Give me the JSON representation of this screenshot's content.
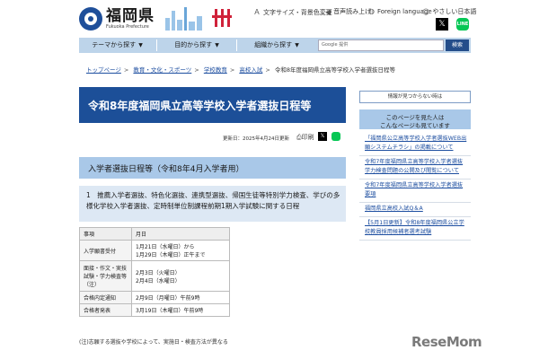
{
  "header": {
    "logo_main": "福岡県",
    "logo_sub": "Fukuoka Prefecture",
    "utilities": [
      {
        "icon": "text-size-icon",
        "label": "文字サイズ・背景色変更"
      },
      {
        "icon": "speaker-icon",
        "label": "音声読み上げ"
      },
      {
        "icon": "globe-icon",
        "label": "Foreign language"
      },
      {
        "icon": "smile-icon",
        "label": "やさしい日本語"
      }
    ],
    "x_label": "𝕏",
    "line_label": "LINE"
  },
  "nav": {
    "items": [
      "テーマから探す",
      "目的から探す",
      "組織から探す"
    ],
    "search_label": "Google 提供",
    "search_button": "検索"
  },
  "breadcrumb": {
    "links": [
      "トップページ",
      "教育・文化・スポーツ",
      "学校教育",
      "高校入試"
    ],
    "current": "令和8年度福岡県立高等学校入学者選抜日程等"
  },
  "main": {
    "title": "令和8年度福岡県立高等学校入学者選抜日程等",
    "updated": "更新日：2025年4月24日更新",
    "print_label": "印刷",
    "section_heading": "入学者選抜日程等（令和8年4月入学者用）",
    "subsection_text": "1　推薦入学者選抜、特色化選抜、連携型選抜、帰国生徒等特別学力検査、学びの多様化学校入学者選抜、定時制単位制課程前期1期入学試験に関する日程",
    "table": {
      "headers": [
        "事項",
        "月日"
      ],
      "rows": [
        {
          "item": "入学願書受付",
          "date": "1月21日（水曜日）から\n1月29日（木曜日）正午まで"
        },
        {
          "item": "面接・作文・実技試験・学力検査等（注）",
          "date": "2月3日（火曜日）\n2月4日（水曜日）"
        },
        {
          "item": "合格内定通知",
          "date": "2月9日（月曜日）午前9時"
        },
        {
          "item": "合格者発表",
          "date": "3月19日（木曜日）午前9時"
        }
      ]
    },
    "note": "(注)志願する選抜や学校によって、実施日・検査方法が異なる"
  },
  "sidebar": {
    "feedback": "情報が見つからない時は",
    "head_line1": "このページを見た人は",
    "head_line2": "こんなページも見ています",
    "links": [
      "「福岡県公立高等学校入学者選抜WEB出願システムチラシ」の掲載について",
      "令和7年度福岡県立高等学校入学者選抜学力検査問題の公開及び閲覧について",
      "令和7年度福岡県立高等学校入学者選抜要項",
      "福岡県立高校入試Q＆A",
      "【5月1日更新】令和8年度福岡県公立学校教員採用候補者選考試験"
    ]
  },
  "watermark": "ReseMom"
}
